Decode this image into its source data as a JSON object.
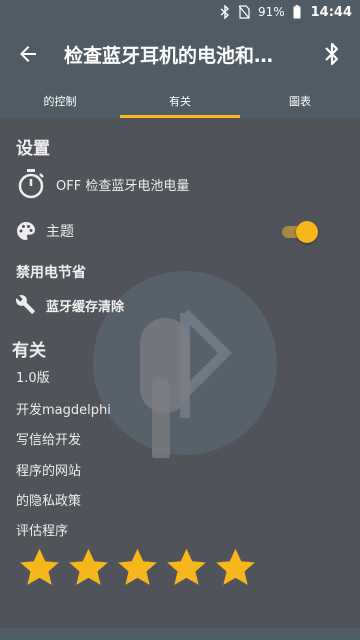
{
  "status_bar": {
    "battery": "91%",
    "time": "14:44"
  },
  "app_bar": {
    "title": "检查蓝牙耳机的电池和…"
  },
  "tabs": [
    {
      "label": "的控制",
      "active": false
    },
    {
      "label": "有关",
      "active": true
    },
    {
      "label": "圖表",
      "active": false
    }
  ],
  "settings": {
    "title": "设置",
    "check_battery": "OFF 检查蓝牙电池电量",
    "theme": "主题",
    "theme_enabled": true,
    "disable_power_saving": "禁用电节省",
    "bt_cache_clear": "蓝牙缓存清除"
  },
  "about": {
    "title": "有关",
    "items": [
      "1.0版",
      "开发magdelphi",
      "写信给开发",
      "程序的网站",
      "的隐私政策",
      "评估程序"
    ]
  },
  "rating": {
    "stars": 5,
    "max": 5
  },
  "colors": {
    "accent": "#f5b71c",
    "bar": "#4f5c66",
    "background": "#505359"
  }
}
